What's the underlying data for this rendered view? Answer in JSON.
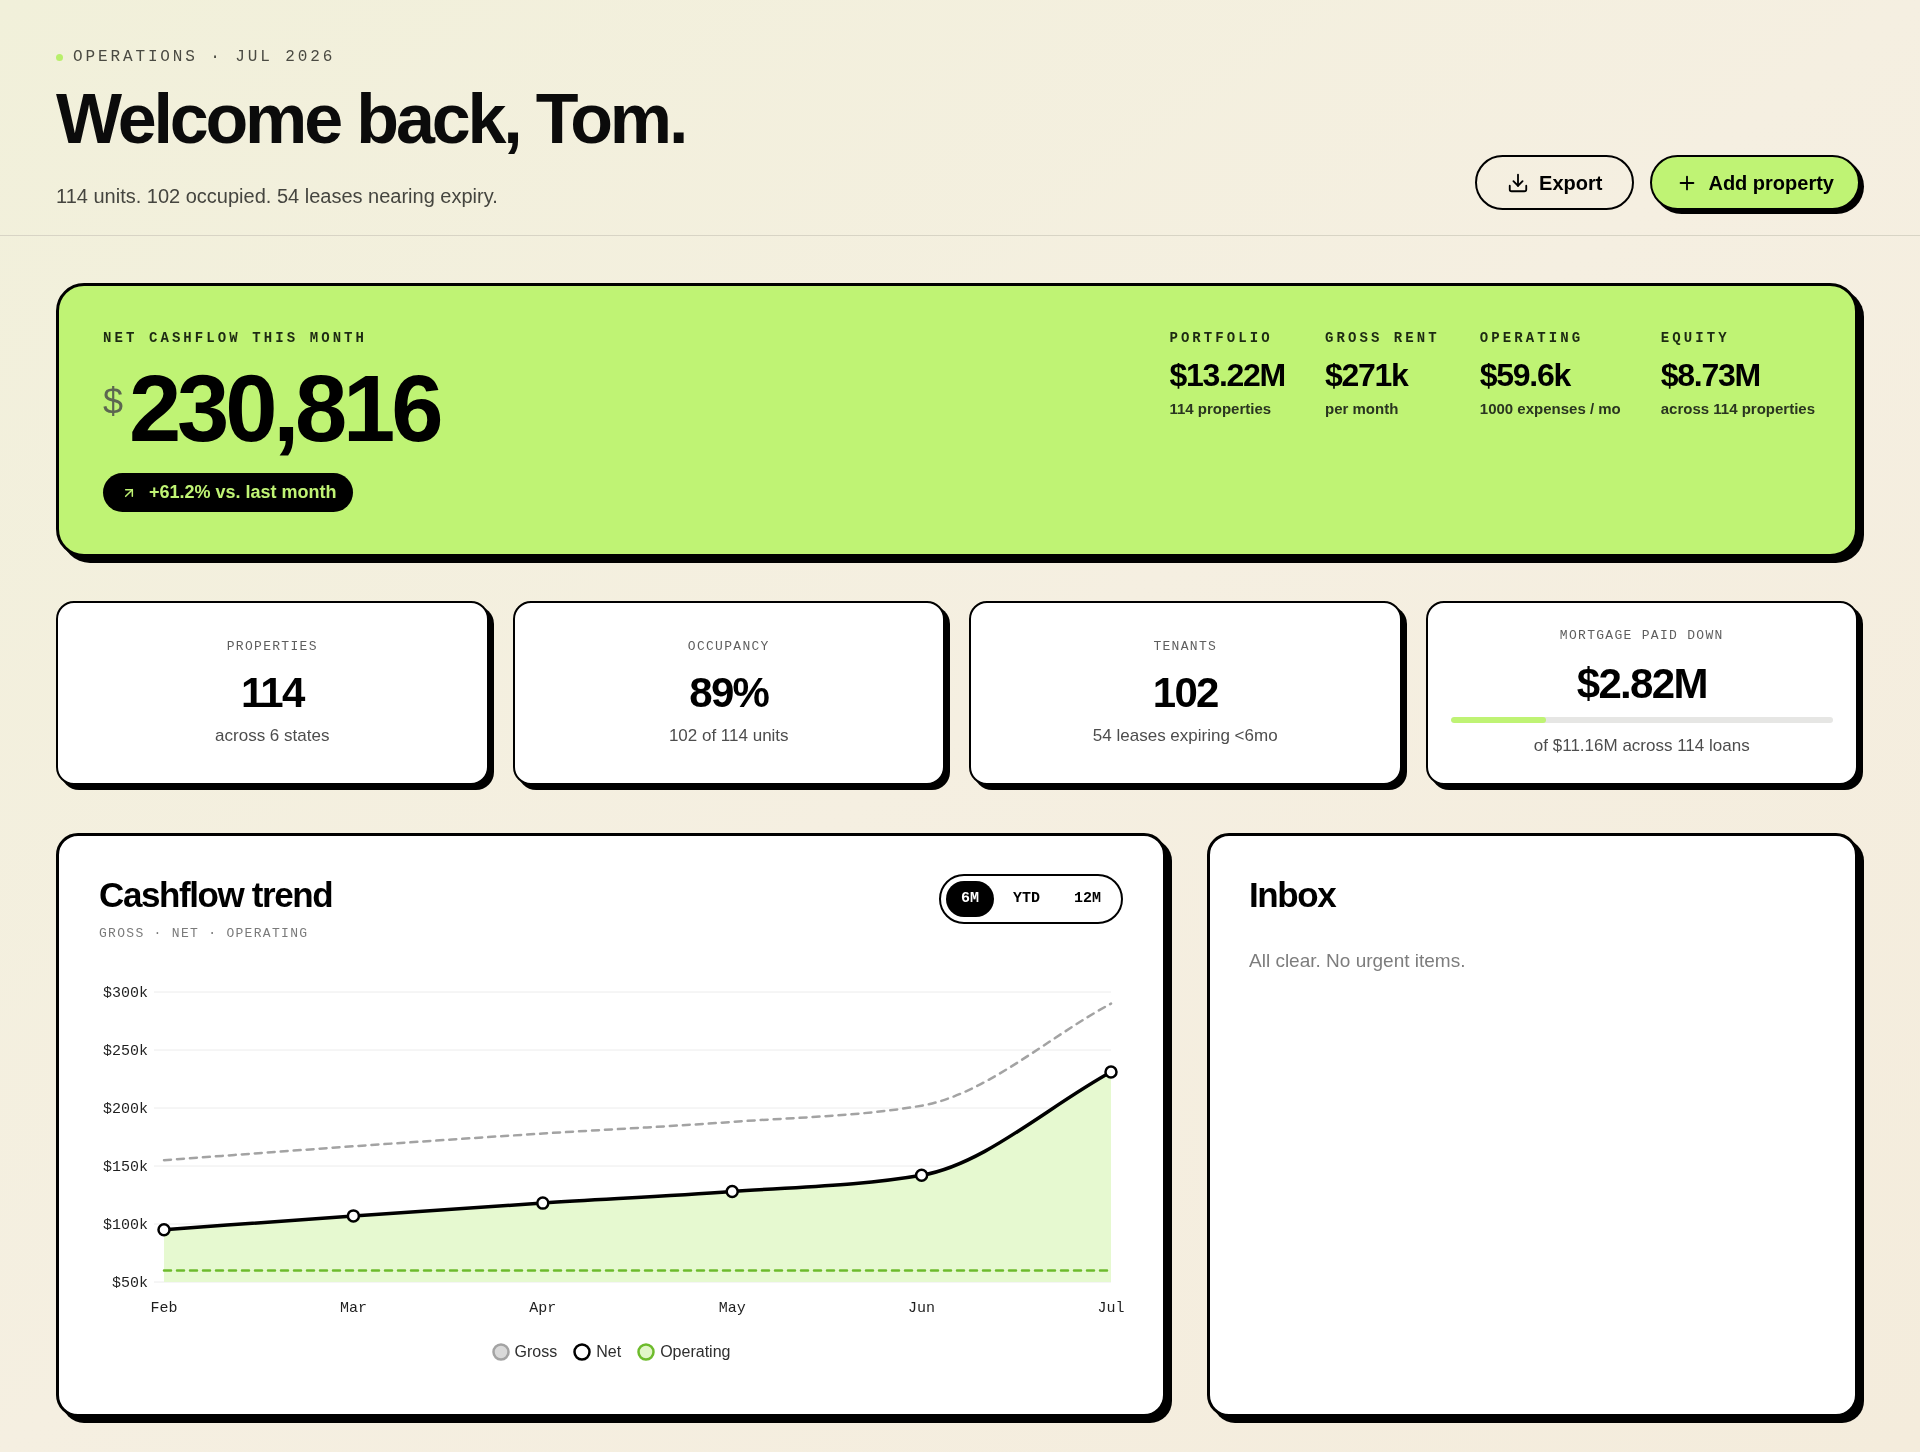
{
  "header": {
    "eyebrow": "OPERATIONS · JUL 2026",
    "title": "Welcome back, Tom.",
    "subtitle": "114 units. 102 occupied. 54 leases nearing expiry.",
    "actions": [
      {
        "label": "Export",
        "kind": "outline"
      },
      {
        "label": "Add property",
        "kind": "filled"
      }
    ]
  },
  "summary": {
    "label": "NET CASHFLOW THIS MONTH",
    "currency": "$",
    "value": "230,816",
    "change": "+61.2% vs. last month",
    "stats": [
      {
        "label": "PORTFOLIO",
        "value": "$13.22M",
        "note": "114 properties"
      },
      {
        "label": "GROSS RENT",
        "value": "$271k",
        "note": "per month"
      },
      {
        "label": "OPERATING",
        "value": "$59.6k",
        "note": "1000 expenses / mo"
      },
      {
        "label": "EQUITY",
        "value": "$8.73M",
        "note": "across 114 properties"
      }
    ]
  },
  "stat_cards": [
    {
      "kind": "plain",
      "label": "PROPERTIES",
      "value": "114",
      "note": "across 6 states"
    },
    {
      "kind": "plain",
      "label": "OCCUPANCY",
      "value": "89%",
      "note": "102 of 114 units"
    },
    {
      "kind": "plain",
      "label": "TENANTS",
      "value": "102",
      "note": "54 leases expiring <6mo"
    },
    {
      "kind": "progress",
      "label": "MORTGAGE PAID DOWN",
      "value": "$2.82M",
      "note": "of $11.16M across 114 loans",
      "level": 0.25
    }
  ],
  "cashflow": {
    "title": "Cashflow trend",
    "subtitle": "GROSS · NET · OPERATING",
    "ranges": [
      {
        "label": "6M",
        "selected": true
      },
      {
        "label": "YTD",
        "selected": false
      },
      {
        "label": "12M",
        "selected": false
      }
    ],
    "chart_data": {
      "type": "line",
      "categories": [
        "Feb",
        "Mar",
        "Apr",
        "May",
        "Jun",
        "Jul"
      ],
      "series": [
        {
          "name": "Gross",
          "color": "#a3a3a3",
          "type": "line",
          "line_style": "dashed",
          "values": [
            155000,
            167000,
            178000,
            188000,
            202000,
            290000
          ]
        },
        {
          "name": "Net",
          "color": "#000000",
          "type": "area",
          "line_style": "solid",
          "marker": "circle",
          "values": [
            95000,
            107000,
            118000,
            128000,
            142000,
            231000
          ]
        },
        {
          "name": "Operating",
          "color": "#6dbb2c",
          "type": "line",
          "line_style": "dashed",
          "values": [
            60000,
            60000,
            60000,
            60000,
            60000,
            60000
          ]
        }
      ],
      "ylim": [
        50000,
        300000
      ],
      "yticks": [
        {
          "value": 50000,
          "label": "$50k"
        },
        {
          "value": 100000,
          "label": "$100k"
        },
        {
          "value": 150000,
          "label": "$150k"
        },
        {
          "value": 200000,
          "label": "$200k"
        },
        {
          "value": 250000,
          "label": "$250k"
        },
        {
          "value": 300000,
          "label": "$300k"
        }
      ],
      "grid": true,
      "legend": "bottom"
    }
  },
  "inbox": {
    "title": "Inbox",
    "empty_message": "All clear. No urgent items."
  }
}
